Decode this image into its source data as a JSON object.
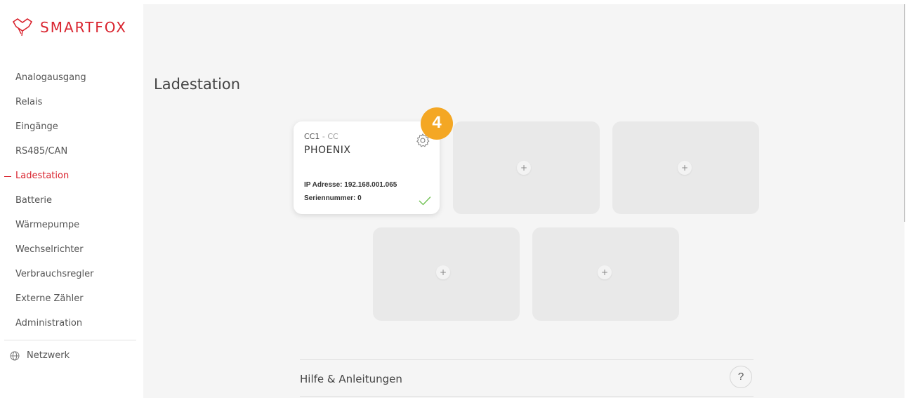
{
  "brand": {
    "name": "SMARTFOX"
  },
  "sidebar": {
    "items": [
      {
        "label": "Analogausgang"
      },
      {
        "label": "Relais"
      },
      {
        "label": "Eingänge"
      },
      {
        "label": "RS485/CAN"
      },
      {
        "label": "Ladestation",
        "active": true
      },
      {
        "label": "Batterie"
      },
      {
        "label": "Wärmepumpe"
      },
      {
        "label": "Wechselrichter"
      },
      {
        "label": "Verbrauchsregler"
      },
      {
        "label": "Externe Zähler"
      },
      {
        "label": "Administration"
      }
    ],
    "network": {
      "label": "Netzwerk",
      "icon": "globe-icon"
    }
  },
  "main": {
    "title": "Ladestation",
    "card": {
      "slot_prefix": "CC1",
      "slot_suffix": "- CC",
      "brand": "PHOENIX",
      "ip": "IP Adresse: 192.168.001.065",
      "serial": "Seriennummer: 0",
      "status_icon": "check-icon",
      "settings_icon": "gear-icon"
    },
    "empty_slot_symbol": "+",
    "badge": "4",
    "help": {
      "label": "Hilfe & Anleitungen",
      "icon_text": "?"
    }
  },
  "colors": {
    "accent": "#d9232e",
    "badge": "#f4a724",
    "check": "#6abf4b"
  }
}
